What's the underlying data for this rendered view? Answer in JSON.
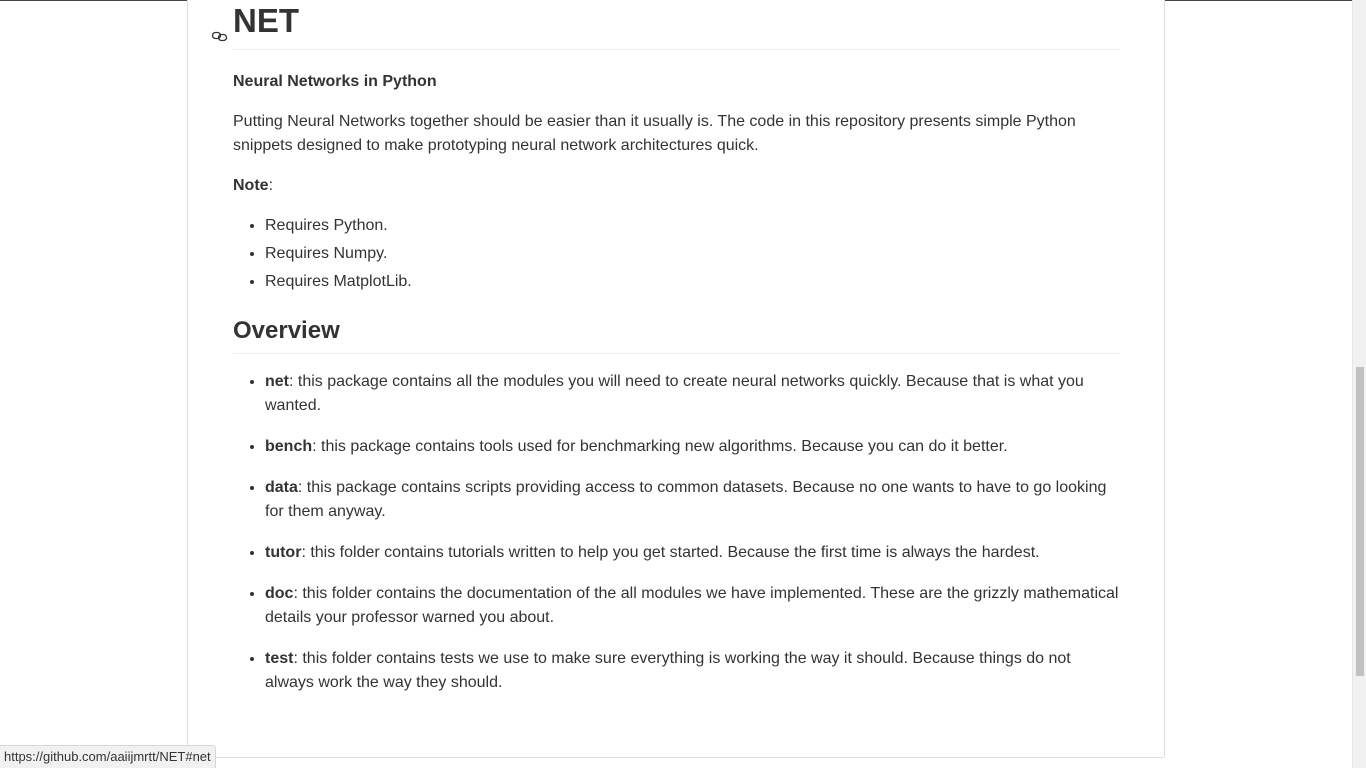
{
  "readme": {
    "title": "NET",
    "subtitle": "Neural Networks in Python",
    "intro": "Putting Neural Networks together should be easier than it usually is. The code in this repository presents simple Python snippets designed to make prototyping neural network architectures quick.",
    "note_label": "Note",
    "note_colon": ":",
    "requirements": [
      "Requires Python.",
      "Requires Numpy.",
      "Requires MatplotLib."
    ],
    "overview_title": "Overview",
    "overview_items": [
      {
        "name": "net",
        "desc": ": this package contains all the modules you will need to create neural networks quickly. Because that is what you wanted."
      },
      {
        "name": "bench",
        "desc": ": this package contains tools used for benchmarking new algorithms. Because you can do it better."
      },
      {
        "name": "data",
        "desc": ": this package contains scripts providing access to common datasets. Because no one wants to have to go looking for them anyway."
      },
      {
        "name": "tutor",
        "desc": ": this folder contains tutorials written to help you get started. Because the first time is always the hardest."
      },
      {
        "name": "doc",
        "desc": ": this folder contains the documentation of the all modules we have implemented. These are the grizzly mathematical details your professor warned you about."
      },
      {
        "name": "test",
        "desc": ": this folder contains tests we use to make sure everything is working the way it should. Because things do not always work the way they should."
      }
    ]
  },
  "status_bar": {
    "url": "https://github.com/aaiijmrtt/NET#net"
  },
  "icons": {
    "anchor": "link-icon"
  },
  "colors": {
    "text": "#333333",
    "border": "#dddddd",
    "heading_rule": "#eeeeee"
  }
}
